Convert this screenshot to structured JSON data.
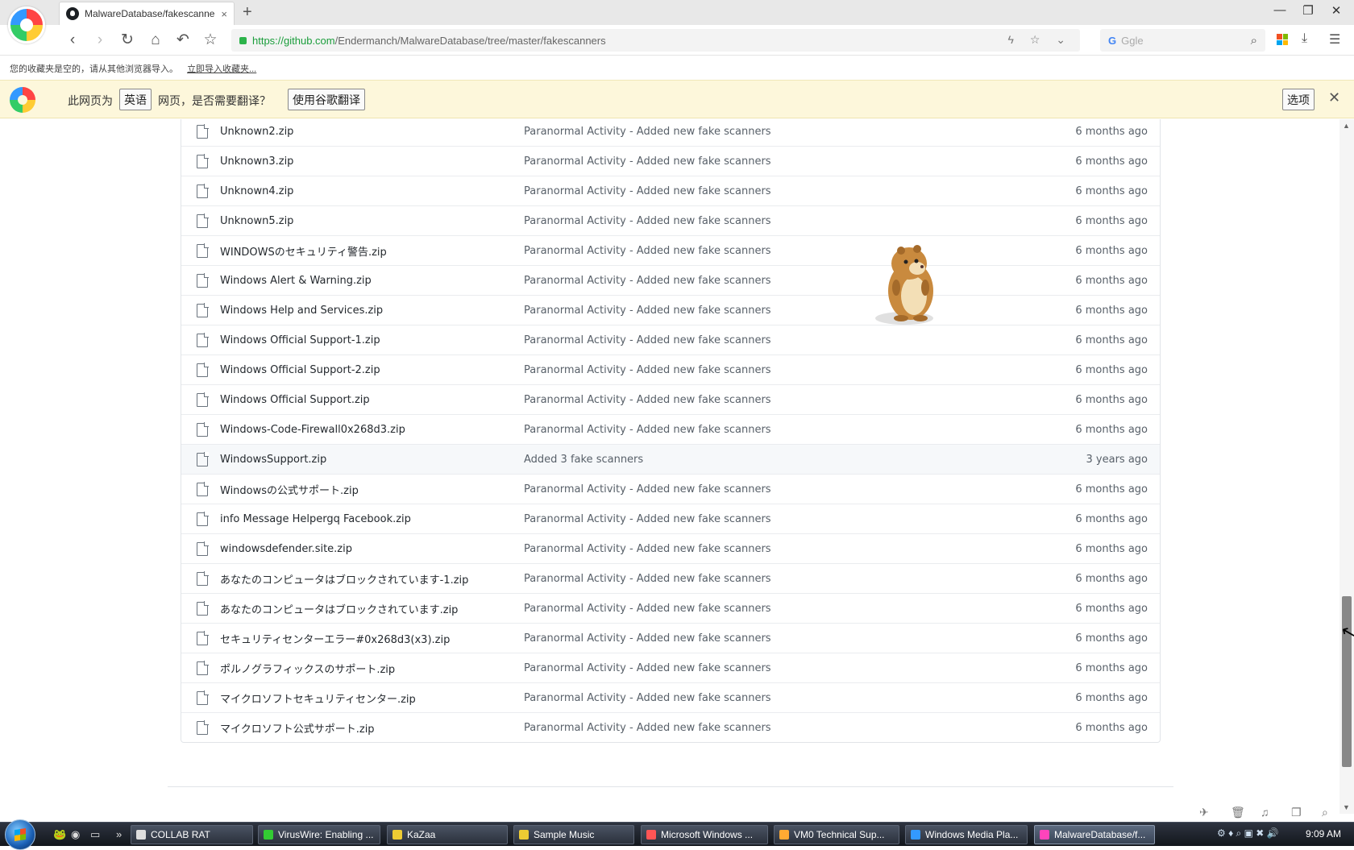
{
  "browser": {
    "tab_title": "MalwareDatabase/fakescanne",
    "tab_close": "×",
    "new_tab": "+",
    "url_host": "https://github.com",
    "url_path": "/Endermanch/MalwareDatabase/tree/master/fakescanners",
    "search_placeholder": "Ggle",
    "window_buttons": [
      "—",
      "❐",
      "✕"
    ]
  },
  "bookmarks": {
    "empty_text": "您的收藏夹是空的，请从其他浏览器导入。",
    "import_link": "立即导入收藏夹..."
  },
  "translate": {
    "prefix": "此网页为",
    "language": "英语",
    "question": "网页，是否需要翻译？",
    "translate_button": "使用谷歌翻译",
    "options_button": "选项",
    "close": "✕"
  },
  "files": [
    {
      "name": "Unknown2.zip",
      "commit": "Paranormal Activity - Added new fake scanners",
      "age": "6 months ago"
    },
    {
      "name": "Unknown3.zip",
      "commit": "Paranormal Activity - Added new fake scanners",
      "age": "6 months ago"
    },
    {
      "name": "Unknown4.zip",
      "commit": "Paranormal Activity - Added new fake scanners",
      "age": "6 months ago"
    },
    {
      "name": "Unknown5.zip",
      "commit": "Paranormal Activity - Added new fake scanners",
      "age": "6 months ago"
    },
    {
      "name": "WINDOWSのセキュリティ警告.zip",
      "commit": "Paranormal Activity - Added new fake scanners",
      "age": "6 months ago"
    },
    {
      "name": "Windows Alert & Warning.zip",
      "commit": "Paranormal Activity - Added new fake scanners",
      "age": "6 months ago"
    },
    {
      "name": "Windows Help and Services.zip",
      "commit": "Paranormal Activity - Added new fake scanners",
      "age": "6 months ago"
    },
    {
      "name": "Windows Official Support-1.zip",
      "commit": "Paranormal Activity - Added new fake scanners",
      "age": "6 months ago"
    },
    {
      "name": "Windows Official Support-2.zip",
      "commit": "Paranormal Activity - Added new fake scanners",
      "age": "6 months ago"
    },
    {
      "name": "Windows Official Support.zip",
      "commit": "Paranormal Activity - Added new fake scanners",
      "age": "6 months ago"
    },
    {
      "name": "Windows-Code-Firewall0x268d3.zip",
      "commit": "Paranormal Activity - Added new fake scanners",
      "age": "6 months ago"
    },
    {
      "name": "WindowsSupport.zip",
      "commit": "Added 3 fake scanners",
      "age": "3 years ago",
      "highlight": true
    },
    {
      "name": "Windowsの公式サポート.zip",
      "commit": "Paranormal Activity - Added new fake scanners",
      "age": "6 months ago"
    },
    {
      "name": "info Message Helpergq Facebook.zip",
      "commit": "Paranormal Activity - Added new fake scanners",
      "age": "6 months ago"
    },
    {
      "name": "windowsdefender.site.zip",
      "commit": "Paranormal Activity - Added new fake scanners",
      "age": "6 months ago"
    },
    {
      "name": "あなたのコンピュータはブロックされています-1.zip",
      "commit": "Paranormal Activity - Added new fake scanners",
      "age": "6 months ago"
    },
    {
      "name": "あなたのコンピュータはブロックされています.zip",
      "commit": "Paranormal Activity - Added new fake scanners",
      "age": "6 months ago"
    },
    {
      "name": "セキュリティセンターエラー#0x268d3(x3).zip",
      "commit": "Paranormal Activity - Added new fake scanners",
      "age": "6 months ago"
    },
    {
      "name": "ポルノグラフィックスのサポート.zip",
      "commit": "Paranormal Activity - Added new fake scanners",
      "age": "6 months ago"
    },
    {
      "name": "マイクロソフトセキュリティセンター.zip",
      "commit": "Paranormal Activity - Added new fake scanners",
      "age": "6 months ago"
    },
    {
      "name": "マイクロソフト公式サポート.zip",
      "commit": "Paranormal Activity - Added new fake scanners",
      "age": "6 months ago"
    }
  ],
  "taskbar": {
    "tasks": [
      {
        "label": "COLLAB RAT",
        "color": "#ddd"
      },
      {
        "label": "VirusWire: Enabling ...",
        "color": "#3c3"
      },
      {
        "label": "KaZaa",
        "color": "#ec3"
      },
      {
        "label": "Sample Music",
        "color": "#ec3"
      },
      {
        "label": "Microsoft Windows ...",
        "color": "#f55"
      },
      {
        "label": "VM0 Technical Sup...",
        "color": "#fa3"
      },
      {
        "label": "Windows Media Pla...",
        "color": "#39f"
      },
      {
        "label": "MalwareDatabase/f...",
        "color": "#f4b",
        "active": true
      }
    ],
    "clock": "9:09 AM"
  },
  "colors": {
    "translate_bar": "#fdf7db",
    "link_green": "#1a9d3b",
    "row_highlight": "#f6f8fa"
  }
}
